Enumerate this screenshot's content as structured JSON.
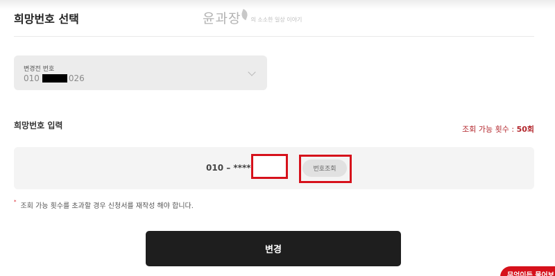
{
  "page": {
    "title": "희망번호 선택"
  },
  "watermark": {
    "main": "윤과장",
    "sub": "의 소소한 일상 이야기"
  },
  "current_number": {
    "label": "변경전 번호",
    "prefix": "010",
    "suffix": "026"
  },
  "desired_number": {
    "title": "희망번호 입력",
    "count_label": "조회 가능 횟수 : ",
    "count_value": "50회",
    "prefix": "010 – ****",
    "input_value": "",
    "lookup_label": "번호조회"
  },
  "note": {
    "bullet": "*",
    "text": "조회 가능 횟수를 초과할 경우 신청서를 재작성 해야 합니다."
  },
  "submit": {
    "label": "변경"
  },
  "chat": {
    "label": "무엇이든 물어보"
  },
  "colors": {
    "accent_red": "#d6111b",
    "count_red": "#b3262c",
    "button_dark": "#1e1e1e"
  }
}
